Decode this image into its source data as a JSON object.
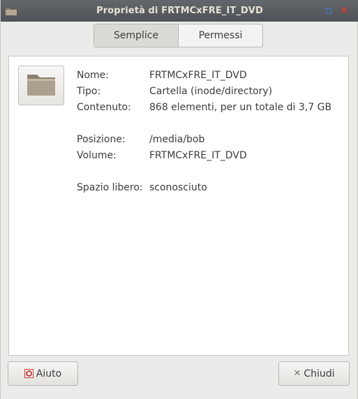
{
  "window": {
    "title": "Proprietà di FRTMCxFRE_IT_DVD"
  },
  "tabs": [
    {
      "label": "Semplice",
      "active": true
    },
    {
      "label": "Permessi",
      "active": false
    }
  ],
  "info": {
    "name_label": "Nome:",
    "name_value": "FRTMCxFRE_IT_DVD",
    "type_label": "Tipo:",
    "type_value": "Cartella (inode/directory)",
    "contents_label": "Contenuto:",
    "contents_value": "868 elementi, per un totale di 3,7 GB",
    "location_label": "Posizione:",
    "location_value": "/media/bob",
    "volume_label": "Volume:",
    "volume_value": "FRTMCxFRE_IT_DVD",
    "free_label": "Spazio libero:",
    "free_value": "sconosciuto"
  },
  "buttons": {
    "help_label": "Aiuto",
    "close_label": "Chiudi"
  },
  "icons": {
    "window": "folder-icon",
    "maximize": "maximize-icon",
    "close": "close-icon",
    "main": "folder-icon",
    "help": "help-icon",
    "close_button": "x-icon"
  },
  "colors": {
    "titlebar": "#55595d",
    "title_text": "#e6e1d7",
    "close_icon": "#e53b2c",
    "maximize_icon": "#3d7ed8",
    "folder": "#a79a88"
  }
}
